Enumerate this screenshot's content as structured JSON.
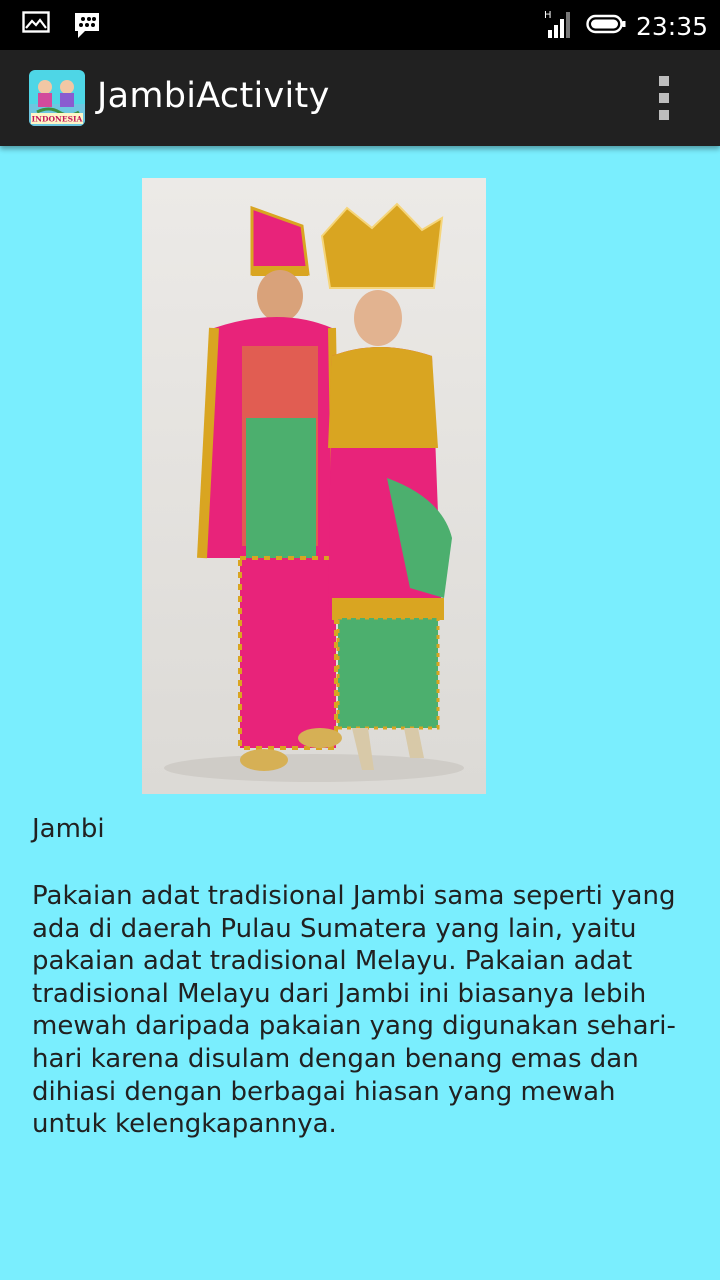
{
  "status_bar": {
    "time": "23:35",
    "icons": [
      "gallery-icon",
      "bbm-icon",
      "signal-icon",
      "battery-icon"
    ],
    "network_label": "H"
  },
  "app_bar": {
    "title": "JambiActivity",
    "app_icon_text": "INDONESIA"
  },
  "article": {
    "heading": "Jambi",
    "body": "Pakaian adat tradisional Jambi sama seperti yang ada di daerah Pulau Sumatera yang lain, yaitu pakaian adat tradisional Melayu. Pakaian adat tradisional Melayu dari Jambi ini biasanya lebih mewah daripada pakaian yang digunakan sehari-hari karena disulam dengan benang emas dan dihiasi dengan berbagai hiasan yang mewah untuk kelengkapannya."
  },
  "colors": {
    "background": "#7aeefe",
    "app_bar": "#212121",
    "status_bar": "#000000",
    "costume_pink": "#e8237a",
    "costume_gold": "#d9a521",
    "costume_green": "#4caf6e"
  }
}
